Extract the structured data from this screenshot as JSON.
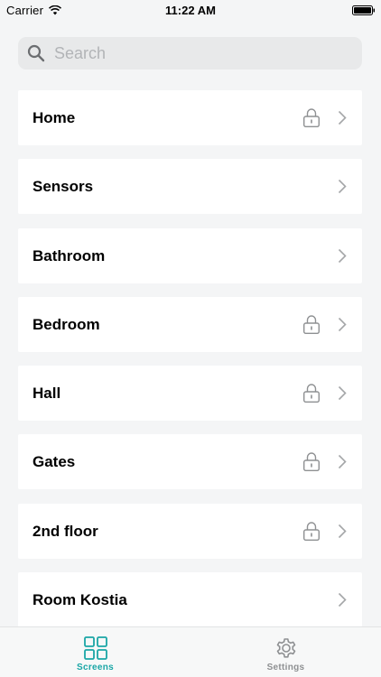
{
  "status_bar": {
    "carrier": "Carrier",
    "time": "11:22 AM"
  },
  "search": {
    "placeholder": "Search",
    "value": ""
  },
  "rows": [
    {
      "label": "Home",
      "locked": true
    },
    {
      "label": "Sensors",
      "locked": false
    },
    {
      "label": "Bathroom",
      "locked": false
    },
    {
      "label": "Bedroom",
      "locked": true
    },
    {
      "label": "Hall",
      "locked": true
    },
    {
      "label": "Gates",
      "locked": true
    },
    {
      "label": "2nd floor",
      "locked": true
    },
    {
      "label": "Room Kostia",
      "locked": false
    }
  ],
  "tab_bar": {
    "tabs": [
      {
        "label": "Screens",
        "icon": "grid-icon",
        "active": true
      },
      {
        "label": "Settings",
        "icon": "gear-icon",
        "active": false
      }
    ]
  },
  "colors": {
    "accent": "#1aa6a6",
    "inactive": "#8e9092",
    "background": "#f4f5f6"
  }
}
